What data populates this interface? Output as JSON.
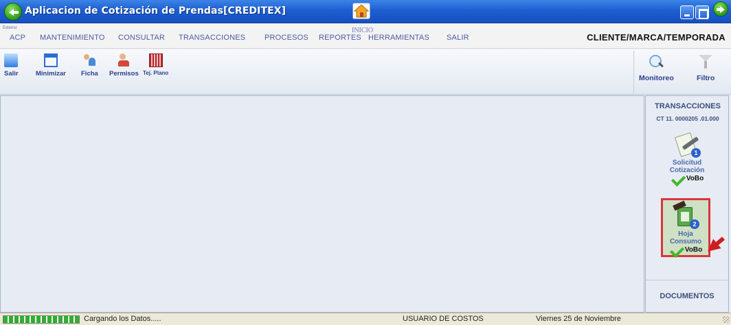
{
  "window": {
    "title": "Aplicacion de Cotización de Prendas[CREDITEX]"
  },
  "menu": {
    "tiny_label": "Exterior",
    "items": [
      "ACP",
      "MANTENIMIENTO",
      "CONSULTAR",
      "TRANSACCIONES",
      "PROCESOS",
      "REPORTES",
      "HERRAMIENTAS",
      "SALIR"
    ],
    "home_label": "INICIO",
    "context": "CLIENTE/MARCA/TEMPORADA"
  },
  "toolbar": {
    "left_buttons": [
      {
        "label": "Salir",
        "icon": "exit-icon"
      },
      {
        "label": "Minimizar",
        "icon": "minimize-window-icon"
      },
      {
        "label": "Ficha",
        "icon": "users-icon"
      },
      {
        "label": "Permisos",
        "icon": "permissions-icon"
      },
      {
        "label": "Tej. Plano",
        "icon": "fabric-icon"
      }
    ],
    "right_buttons": [
      {
        "label": "Monitoreo",
        "icon": "magnifier-icon"
      },
      {
        "label": "Filtro",
        "icon": "filter-icon"
      }
    ]
  },
  "panel": {
    "title": "TRANSACCIONES",
    "code": "CT 11. 0000205 .01.000",
    "steps": [
      {
        "number": "1",
        "line1": "Solicitud",
        "line2": "Cotización",
        "status": "VoBo",
        "selected": false
      },
      {
        "number": "2",
        "line1": "Hoja",
        "line2": "Consumo",
        "status": "VoBo",
        "selected": true
      }
    ],
    "footer": "DOCUMENTOS"
  },
  "status": {
    "loading": "Cargando los Datos.....",
    "user": "USUARIO DE COSTOS",
    "date": "Viernes 25 de Noviembre"
  },
  "colors": {
    "title_bar": "#1d5fd0",
    "menu_text": "#4a5aa0",
    "panel_text": "#3b4f7a",
    "highlight_border": "#d9363b",
    "progress": "#2fb02f"
  }
}
